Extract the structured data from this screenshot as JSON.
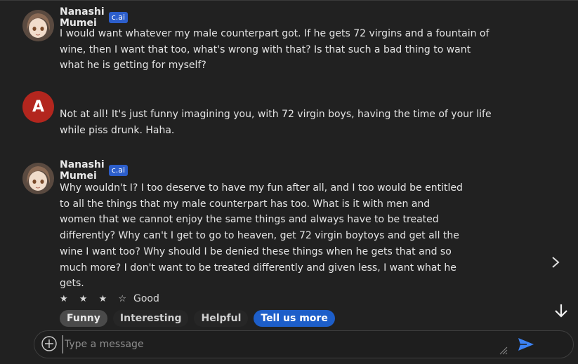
{
  "messages": [
    {
      "name": "Nanashi Mumei",
      "badge": "c.ai",
      "text": "I would want whatever my male counterpart got. If he gets 72 virgins and a fountain of\nwine, then I want that too, what's wrong with that? Is that such a bad thing to want\nwhat he is getting for myself?"
    },
    {
      "avatar_letter": "A",
      "text": "Not at all! It's just funny imagining you, with 72 virgin boys, having the time of your life\nwhile piss drunk. Haha."
    },
    {
      "name": "Nanashi Mumei",
      "badge": "c.ai",
      "text": "Why wouldn't I? I too deserve to have my fun after all, and I too would be entitled\nto all the things that my male counterpart has too. What is it with men and\nwomen that we cannot enjoy the same things and always have to be treated\ndifferently? Why can't I get to go to heaven, get 72 virgin boytoys and get all the\nwine I want too? Why should I be denied these things when he gets that and so\nmuch more? I don't want to be treated differently and given less, I want what he\ngets."
    }
  ],
  "rating": {
    "stars": "★ ★ ★ ☆",
    "label": "Good"
  },
  "feedback_chips": [
    "Funny",
    "Interesting",
    "Helpful",
    "Tell us more"
  ],
  "composer": {
    "placeholder": "Type a message"
  },
  "colors": {
    "background": "#212121",
    "badge": "#2c5ecb",
    "user_avatar": "#b3261e",
    "send": "#3b82f6"
  }
}
